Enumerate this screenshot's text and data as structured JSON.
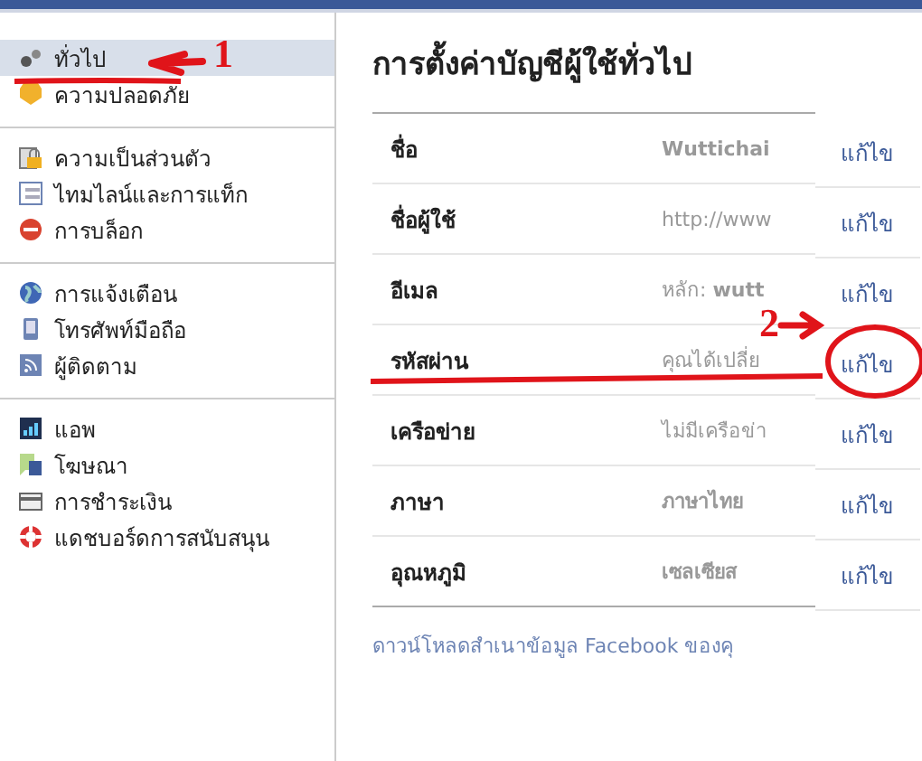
{
  "sidebar": {
    "groups": [
      {
        "items": [
          {
            "label": "ทั่วไป",
            "selected": true
          },
          {
            "label": "ความปลอดภัย",
            "selected": false
          }
        ]
      },
      {
        "items": [
          {
            "label": "ความเป็นส่วนตัว",
            "selected": false
          },
          {
            "label": "ไทมไลน์และการแท็ก",
            "selected": false
          },
          {
            "label": "การบล็อก",
            "selected": false
          }
        ]
      },
      {
        "items": [
          {
            "label": "การแจ้งเตือน",
            "selected": false
          },
          {
            "label": "โทรศัพท์มือถือ",
            "selected": false
          },
          {
            "label": "ผู้ติดตาม",
            "selected": false
          }
        ]
      },
      {
        "items": [
          {
            "label": "แอพ",
            "selected": false
          },
          {
            "label": "โฆษณา",
            "selected": false
          },
          {
            "label": "การชำระเงิน",
            "selected": false
          },
          {
            "label": "แดชบอร์ดการสนับสนุน",
            "selected": false
          }
        ]
      }
    ]
  },
  "main": {
    "title": "การตั้งค่าบัญชีผู้ใช้ทั่วไป",
    "rows": [
      {
        "label": "ชื่อ",
        "value": "Wuttichai",
        "bold": true
      },
      {
        "label": "ชื่อผู้ใช้",
        "value": "http://www",
        "bold": false
      },
      {
        "label": "อีเมล",
        "value": "หลัก: **wutt**",
        "bold": false
      },
      {
        "label": "รหัสผ่าน",
        "value": "คุณได้เปลี่ย",
        "bold": false
      },
      {
        "label": "เครือข่าย",
        "value": "ไม่มีเครือข่า",
        "bold": false
      },
      {
        "label": "ภาษา",
        "value": "ภาษาไทย",
        "bold": true
      },
      {
        "label": "อุณหภูมิ",
        "value": "เซลเซียส",
        "bold": true
      }
    ],
    "footer_link": "ดาวน์โหลดสำเนาข้อมูล Facebook ของคุ",
    "edit_links": [
      "แก้ไข",
      "แก้ไข",
      "แก้ไข",
      "แก้ไข",
      "แก้ไข",
      "แก้ไข",
      "แก้ไข"
    ]
  },
  "annotations": [
    {
      "text": "1"
    },
    {
      "text": "2"
    }
  ]
}
